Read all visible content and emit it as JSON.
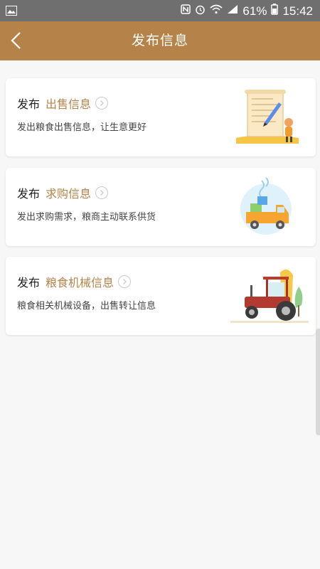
{
  "status_bar": {
    "battery_percent": "61%",
    "time": "15:42",
    "icons": [
      "image-icon",
      "nfc-icon",
      "alarm-icon",
      "wifi-icon",
      "signal-icon",
      "battery-icon"
    ]
  },
  "nav": {
    "title": "发布信息",
    "back_icon": "chevron-left-icon"
  },
  "cards": [
    {
      "prefix": "发布",
      "title": "出售信息",
      "description": "发出粮食出售信息，让生意更好",
      "illustration": "scroll-document-illustration"
    },
    {
      "prefix": "发布",
      "title": "求购信息",
      "description": "发出求购需求，粮商主动联系供货",
      "illustration": "delivery-truck-illustration"
    },
    {
      "prefix": "发布",
      "title": "粮食机械信息",
      "description": "粮食相关机械设备，出售转让信息",
      "illustration": "tractor-illustration"
    }
  ],
  "colors": {
    "accent": "#b5834a",
    "status_bar": "#6f6f6f",
    "background": "#f7f7f7"
  }
}
